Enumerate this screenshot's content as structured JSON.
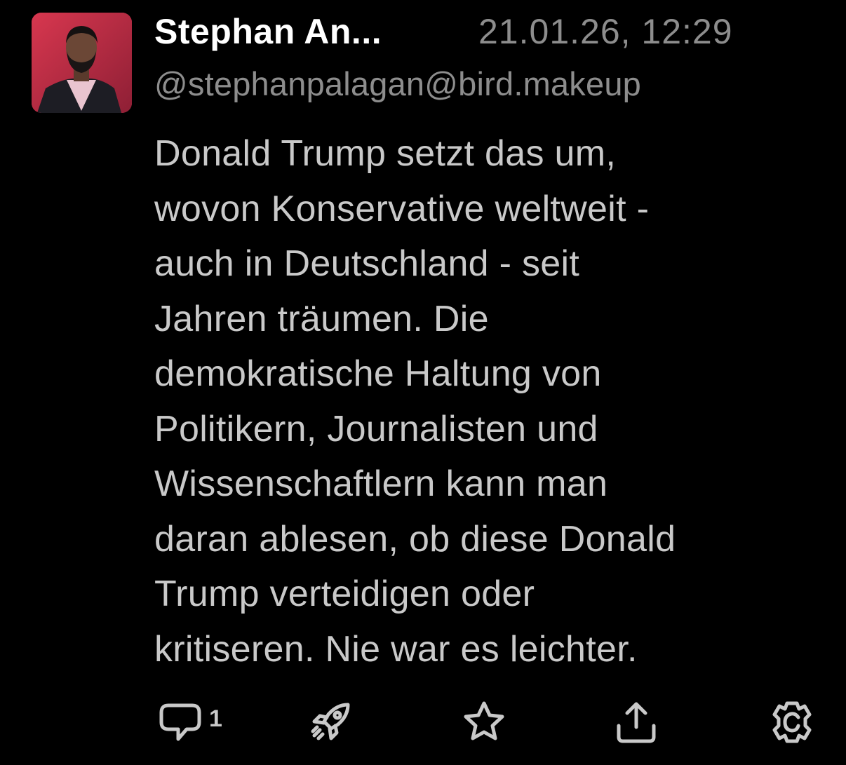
{
  "post": {
    "author": {
      "display_name": "Stephan An...",
      "handle": "@stephanpalagan@bird.makeup",
      "avatar_icon": "avatar-photo"
    },
    "timestamp": "21.01.26, 12:29",
    "body_lines": [
      "Donald Trump setzt das um,",
      "wovon Konservative weltweit -",
      "auch in Deutschland - seit",
      "Jahren träumen. Die",
      "demokratische Haltung von",
      "Politikern, Journalisten und",
      "Wissenschaftlern kann man",
      "daran ablesen, ob diese Donald",
      "Trump verteidigen oder",
      "kritiseren. Nie war es leichter."
    ],
    "actions": {
      "reply_count": "1",
      "reply_icon": "reply-icon",
      "boost_icon": "rocket-icon",
      "favorite_icon": "star-icon",
      "share_icon": "share-icon",
      "more_icon": "settings-icon"
    }
  },
  "colors": {
    "background": "#000000",
    "name": "#ffffff",
    "secondary_text": "#8d8d8d",
    "body_text": "#c9c9c9",
    "avatar_background": "#c8344a"
  }
}
